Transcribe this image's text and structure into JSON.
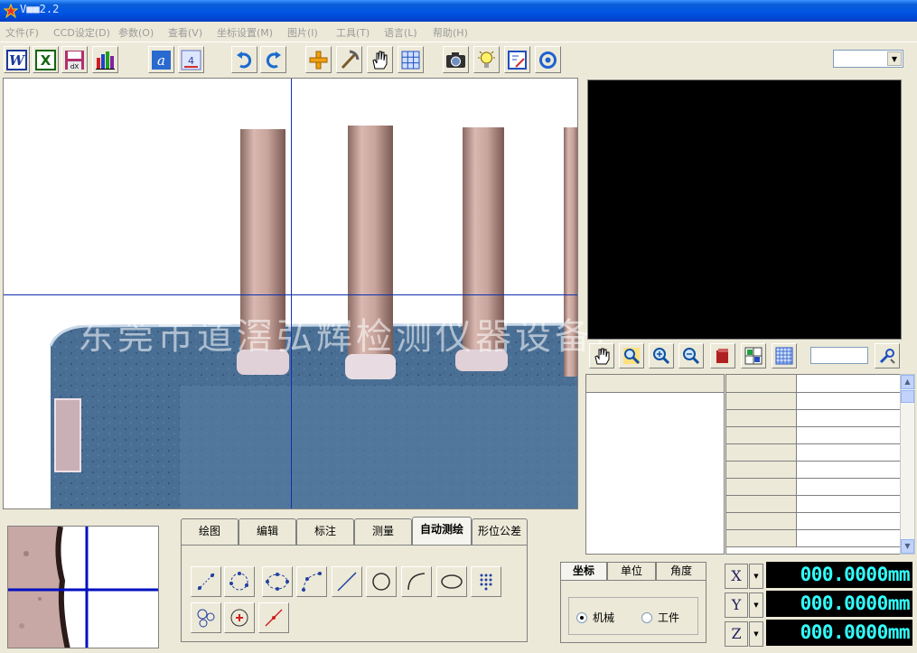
{
  "window": {
    "title": "V■■2.2"
  },
  "menu": [
    {
      "label": "文件(F)"
    },
    {
      "label": "CCD设定(D)"
    },
    {
      "label": "参数(O)"
    },
    {
      "label": "查看(V)"
    },
    {
      "label": "坐标设置(M)"
    },
    {
      "label": "图片(I)"
    },
    {
      "label": "工具(T)"
    },
    {
      "label": "语言(L)"
    },
    {
      "label": "帮助(H)"
    }
  ],
  "toolbar": {
    "buttons": [
      {
        "icon": "word-export-icon"
      },
      {
        "icon": "excel-export-icon"
      },
      {
        "icon": "save-dxf-icon"
      },
      {
        "icon": "statistics-chart-icon"
      },
      {
        "icon": "text-style-icon"
      },
      {
        "icon": "annotation-icon"
      },
      {
        "icon": "undo-icon"
      },
      {
        "icon": "redo-icon"
      },
      {
        "icon": "crosshair-icon"
      },
      {
        "icon": "pickaxe-icon"
      },
      {
        "icon": "hand-pan-icon"
      },
      {
        "icon": "grid-icon"
      },
      {
        "icon": "camera-icon"
      },
      {
        "icon": "light-bulb-icon"
      },
      {
        "icon": "image-edit-icon"
      },
      {
        "icon": "rotate-icon"
      }
    ],
    "select_value": ""
  },
  "camera": {
    "watermark": "东莞市道滘弘辉检测仪器设备厂"
  },
  "preview_tools": [
    {
      "icon": "hand-pan-icon"
    },
    {
      "icon": "zoom-fit-icon"
    },
    {
      "icon": "zoom-in-icon"
    },
    {
      "icon": "zoom-out-icon"
    },
    {
      "icon": "eraser-icon"
    },
    {
      "icon": "layout-icon"
    },
    {
      "icon": "grid-icon"
    },
    {
      "icon": "settings-wrench-icon"
    }
  ],
  "zoom_field": "",
  "draw_tabs": [
    {
      "label": "绘图",
      "active": false
    },
    {
      "label": "编辑",
      "active": false
    },
    {
      "label": "标注",
      "active": false
    },
    {
      "label": "测量",
      "active": false
    },
    {
      "label": "自动测绘",
      "active": true
    },
    {
      "label": "形位公差",
      "active": false
    }
  ],
  "draw_tools": [
    {
      "icon": "point-icon"
    },
    {
      "icon": "circle-points-icon"
    },
    {
      "icon": "ellipse-points-icon"
    },
    {
      "icon": "arc-points-icon"
    },
    {
      "icon": "line-icon"
    },
    {
      "icon": "circle-icon"
    },
    {
      "icon": "arc-icon"
    },
    {
      "icon": "ellipse-icon"
    },
    {
      "icon": "dot-matrix-icon"
    },
    {
      "icon": "multi-circle-icon"
    },
    {
      "icon": "center-point-icon"
    },
    {
      "icon": "point-line-icon"
    }
  ],
  "coord_tabs": [
    {
      "label": "坐标",
      "active": true
    },
    {
      "label": "单位",
      "active": false
    },
    {
      "label": "角度",
      "active": false
    }
  ],
  "coord_mode": {
    "options": [
      {
        "label": "机械",
        "checked": true
      },
      {
        "label": "工件",
        "checked": false
      }
    ]
  },
  "dro": [
    {
      "axis": "X",
      "value": "000.0000mm"
    },
    {
      "axis": "Y",
      "value": "000.0000mm"
    },
    {
      "axis": "Z",
      "value": "000.0000mm"
    }
  ],
  "colors": {
    "dro_text": "#33ffff",
    "dro_background": "#000000",
    "crosshair": "#1030b0",
    "chassis": "#ece9d8"
  }
}
